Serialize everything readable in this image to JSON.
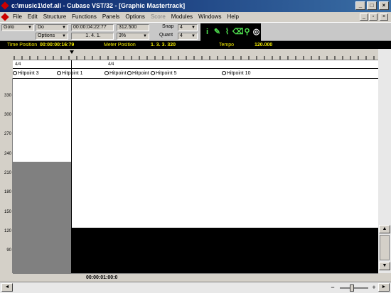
{
  "window": {
    "title": "c:\\music1\\def.all - Cubase VST/32 - [Graphic Mastertrack]",
    "min": "_",
    "max": "□",
    "close": "×"
  },
  "menu": [
    "File",
    "Edit",
    "Structure",
    "Functions",
    "Panels",
    "Options",
    "Score",
    "Modules",
    "Windows",
    "Help"
  ],
  "menu_disabled": [
    "Score"
  ],
  "toolbar": {
    "goto": "Goto",
    "do": "Do",
    "options": "Options",
    "smpte": "00:00:04:22:77",
    "pos": "1. 4. 1.",
    "tempo_val": "312.500",
    "percent": "3%",
    "snap_label": "Snap",
    "snap_val": "4",
    "quant_label": "Quant",
    "quant_val": "4"
  },
  "status": {
    "time_label": "Time Position",
    "time_val": "00:00:00:16:79",
    "meter_label": "Meter Position",
    "meter_val": "1. 3. 3. 320",
    "tempo_label": "Tempo",
    "tempo_val": "120.000"
  },
  "signatures": [
    "4/4",
    "4/4"
  ],
  "hitpoints": [
    "Hitpoint 3",
    "Hitpoint 1",
    "Hitpoint 2",
    "Hitpoint 4",
    "Hitpoint 5",
    "Hitpoint 10"
  ],
  "yaxis": [
    "330",
    "300",
    "270",
    "240",
    "210",
    "180",
    "150",
    "120",
    "90"
  ],
  "bottom_time": "00:00:01:00:0"
}
